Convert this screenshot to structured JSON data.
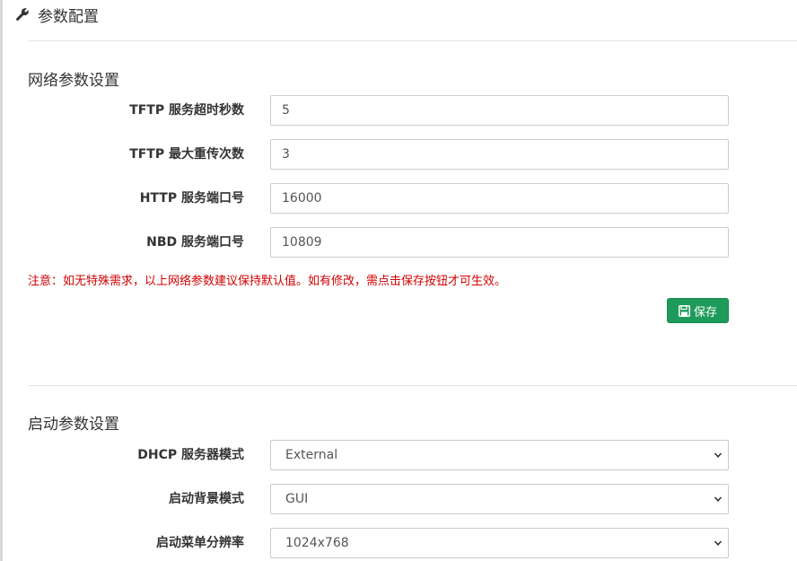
{
  "header": {
    "title": "参数配置",
    "icon": "wrench-icon"
  },
  "network": {
    "title": "网络参数设置",
    "fields": [
      {
        "label": "TFTP 服务超时秒数",
        "value": "5"
      },
      {
        "label": "TFTP 最大重传次数",
        "value": "3"
      },
      {
        "label": "HTTP 服务端口号",
        "value": "16000"
      },
      {
        "label": "NBD 服务端口号",
        "value": "10809"
      }
    ],
    "notice": "注意：如无特殊需求，以上网络参数建议保持默认值。如有修改，需点击保存按钮才可生效。",
    "save_label": "保存"
  },
  "boot": {
    "title": "启动参数设置",
    "fields": [
      {
        "label": "DHCP 服务器模式",
        "value": "External"
      },
      {
        "label": "启动背景模式",
        "value": "GUI"
      },
      {
        "label": "启动菜单分辨率",
        "value": "1024x768"
      }
    ]
  },
  "colors": {
    "accent_green": "#1e9b5a",
    "notice_red": "#d00000"
  }
}
